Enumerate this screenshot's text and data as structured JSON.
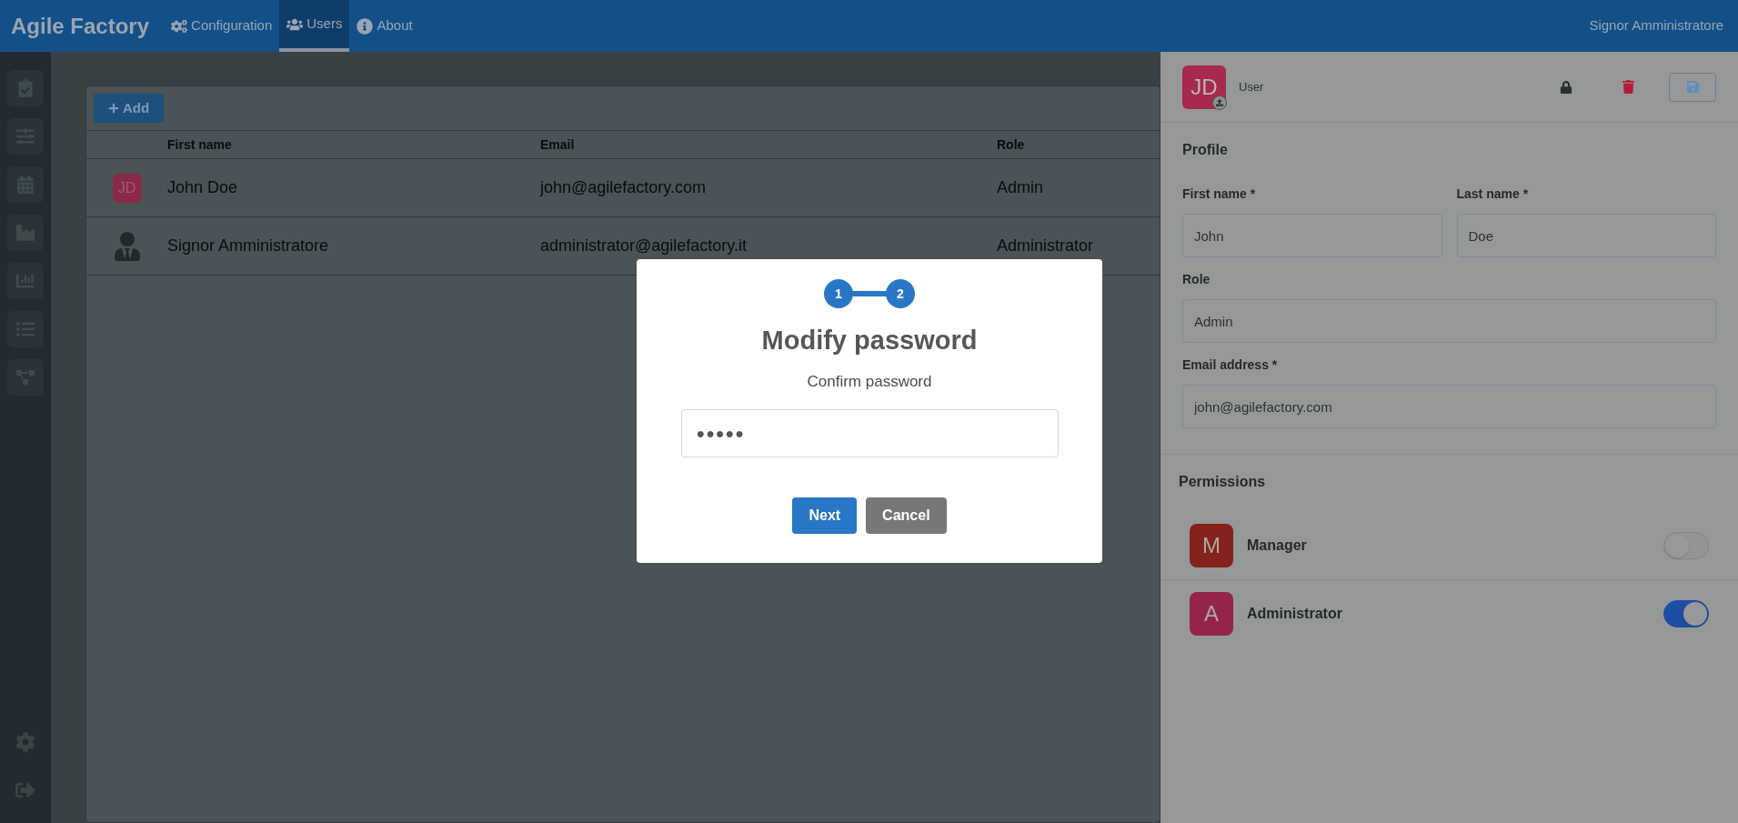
{
  "navbar": {
    "brand": "Agile Factory",
    "items": [
      {
        "label": "Configuration",
        "selected": false
      },
      {
        "label": "Users",
        "selected": true
      },
      {
        "label": "About",
        "selected": false
      }
    ],
    "user": "Signor Amministratore"
  },
  "users_table": {
    "add_button": "Add",
    "columns": [
      "First name",
      "Email",
      "Role"
    ],
    "rows": [
      {
        "avatar": {
          "kind": "initials",
          "text": "JD",
          "color": "#8a2a4a"
        },
        "name": "John Doe",
        "email": "john@agilefactory.com",
        "role": "Admin"
      },
      {
        "avatar": {
          "kind": "person"
        },
        "name": "Signor Amministratore",
        "email": "administrator@agilefactory.it",
        "role": "Administrator"
      }
    ]
  },
  "user_panel": {
    "avatar": "JD",
    "type_label": "User",
    "profile_title": "Profile",
    "fields": [
      {
        "label": "First name *",
        "value": "John"
      },
      {
        "label": "Last name *",
        "value": "Doe"
      },
      {
        "label": "Role",
        "value": "Admin"
      },
      {
        "label": "Email address *",
        "value": "john@agilefactory.com"
      }
    ],
    "permissions_title": "Permissions",
    "permissions": [
      {
        "letter": "M",
        "name": "Manager",
        "color": "#84221c",
        "on": false
      },
      {
        "letter": "A",
        "name": "Administrator",
        "color": "#962449",
        "on": true
      }
    ]
  },
  "modal": {
    "steps": [
      {
        "label": "1"
      },
      {
        "label": "2"
      }
    ],
    "title": "Modify password",
    "subtitle": "Confirm password",
    "password": {
      "value": "●●●●●"
    },
    "buttons": [
      {
        "label": "Next",
        "kind": "primary"
      },
      {
        "label": "Cancel",
        "kind": "secondary"
      }
    ]
  }
}
